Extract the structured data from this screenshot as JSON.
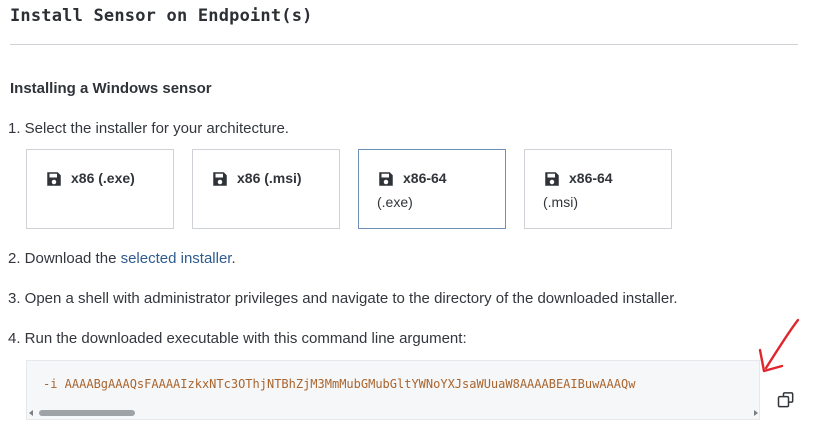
{
  "page": {
    "title": "Install Sensor on Endpoint(s)",
    "section_title": "Installing a Windows sensor"
  },
  "steps": {
    "step1": "1. Select the installer for your architecture.",
    "step2_prefix": "2. Download the ",
    "step2_link": "selected installer",
    "step2_suffix": ".",
    "step3": "3. Open a shell with administrator privileges and navigate to the directory of the downloaded installer.",
    "step4": "4. Run the downloaded executable with this command line argument:"
  },
  "installers": [
    {
      "label_line1": "x86 (.exe)",
      "label_line2": "",
      "selected": false,
      "icon": "floppy-disk-icon"
    },
    {
      "label_line1": "x86 (.msi)",
      "label_line2": "",
      "selected": false,
      "icon": "floppy-disk-icon"
    },
    {
      "label_line1": "x86-64",
      "label_line2": "(.exe)",
      "selected": true,
      "icon": "floppy-disk-icon"
    },
    {
      "label_line1": "x86-64",
      "label_line2": "(.msi)",
      "selected": false,
      "icon": "floppy-disk-icon"
    }
  ],
  "command": {
    "text": "-i AAAABgAAAQsFAAAAIzkxNTc3OThjNTBhZjM3MmMubGMubGltYWNoYXJsaWUuaW8AAAABEAIBuwAAAQw",
    "copy_icon": "copy-icon"
  },
  "colors": {
    "link": "#2e5b8f",
    "selected_border": "#6c90b6",
    "code_text": "#a9652f",
    "annotation_arrow": "#e0262c"
  }
}
